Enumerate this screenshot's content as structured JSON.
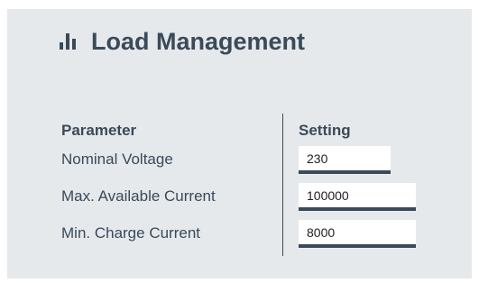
{
  "title": "Load Management",
  "title_icon": "bar-chart-icon",
  "columns": {
    "parameter": "Parameter",
    "setting": "Setting"
  },
  "rows": [
    {
      "label": "Nominal Voltage",
      "value": "230"
    },
    {
      "label": "Max. Available Current",
      "value": "100000"
    },
    {
      "label": "Min. Charge Current",
      "value": "8000"
    }
  ],
  "colors": {
    "panel_background": "#e6e9ec",
    "text": "#3a4a58",
    "input_underline": "#3a4a58"
  }
}
